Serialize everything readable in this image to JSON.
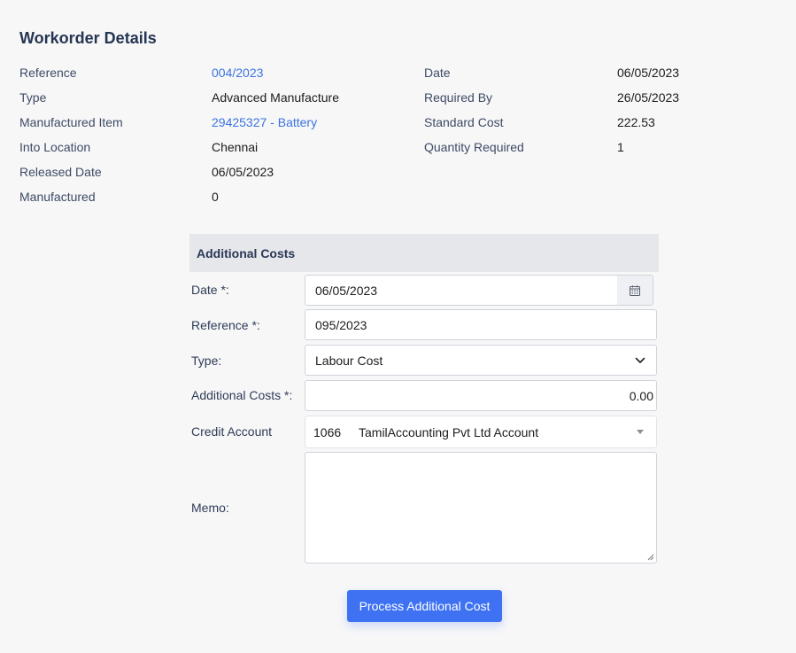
{
  "page": {
    "title": "Workorder Details"
  },
  "details_left": [
    {
      "label": "Reference",
      "value": "004/2023",
      "link": true
    },
    {
      "label": "Type",
      "value": "Advanced Manufacture",
      "link": false
    },
    {
      "label": "Manufactured Item",
      "value": "29425327 - Battery",
      "link": true
    },
    {
      "label": "Into Location",
      "value": "Chennai",
      "link": false
    },
    {
      "label": "Released Date",
      "value": "06/05/2023",
      "link": false
    },
    {
      "label": "Manufactured",
      "value": "0",
      "link": false
    }
  ],
  "details_right": [
    {
      "label": "Date",
      "value": "06/05/2023"
    },
    {
      "label": "Required By",
      "value": "26/05/2023"
    },
    {
      "label": "Standard Cost",
      "value": "222.53"
    },
    {
      "label": "Quantity Required",
      "value": "1"
    }
  ],
  "form": {
    "header": "Additional Costs",
    "date_label": "Date *:",
    "date_value": "06/05/2023",
    "reference_label": "Reference *:",
    "reference_value": "095/2023",
    "type_label": "Type:",
    "type_value": "Labour Cost",
    "costs_label": "Additional Costs *:",
    "costs_value": "0.00",
    "credit_label": "Credit Account",
    "credit_code": "1066",
    "credit_name": "TamilAccounting Pvt Ltd Account",
    "memo_label": "Memo:",
    "memo_value": "",
    "submit_label": "Process Additional Cost"
  },
  "icons": {
    "calendar": "calendar-icon",
    "chevron": "chevron-down-icon",
    "caret": "caret-down-icon"
  },
  "colors": {
    "accent": "#3e72f3",
    "link": "#3b73e0",
    "header_bg": "#e6e7ea"
  }
}
